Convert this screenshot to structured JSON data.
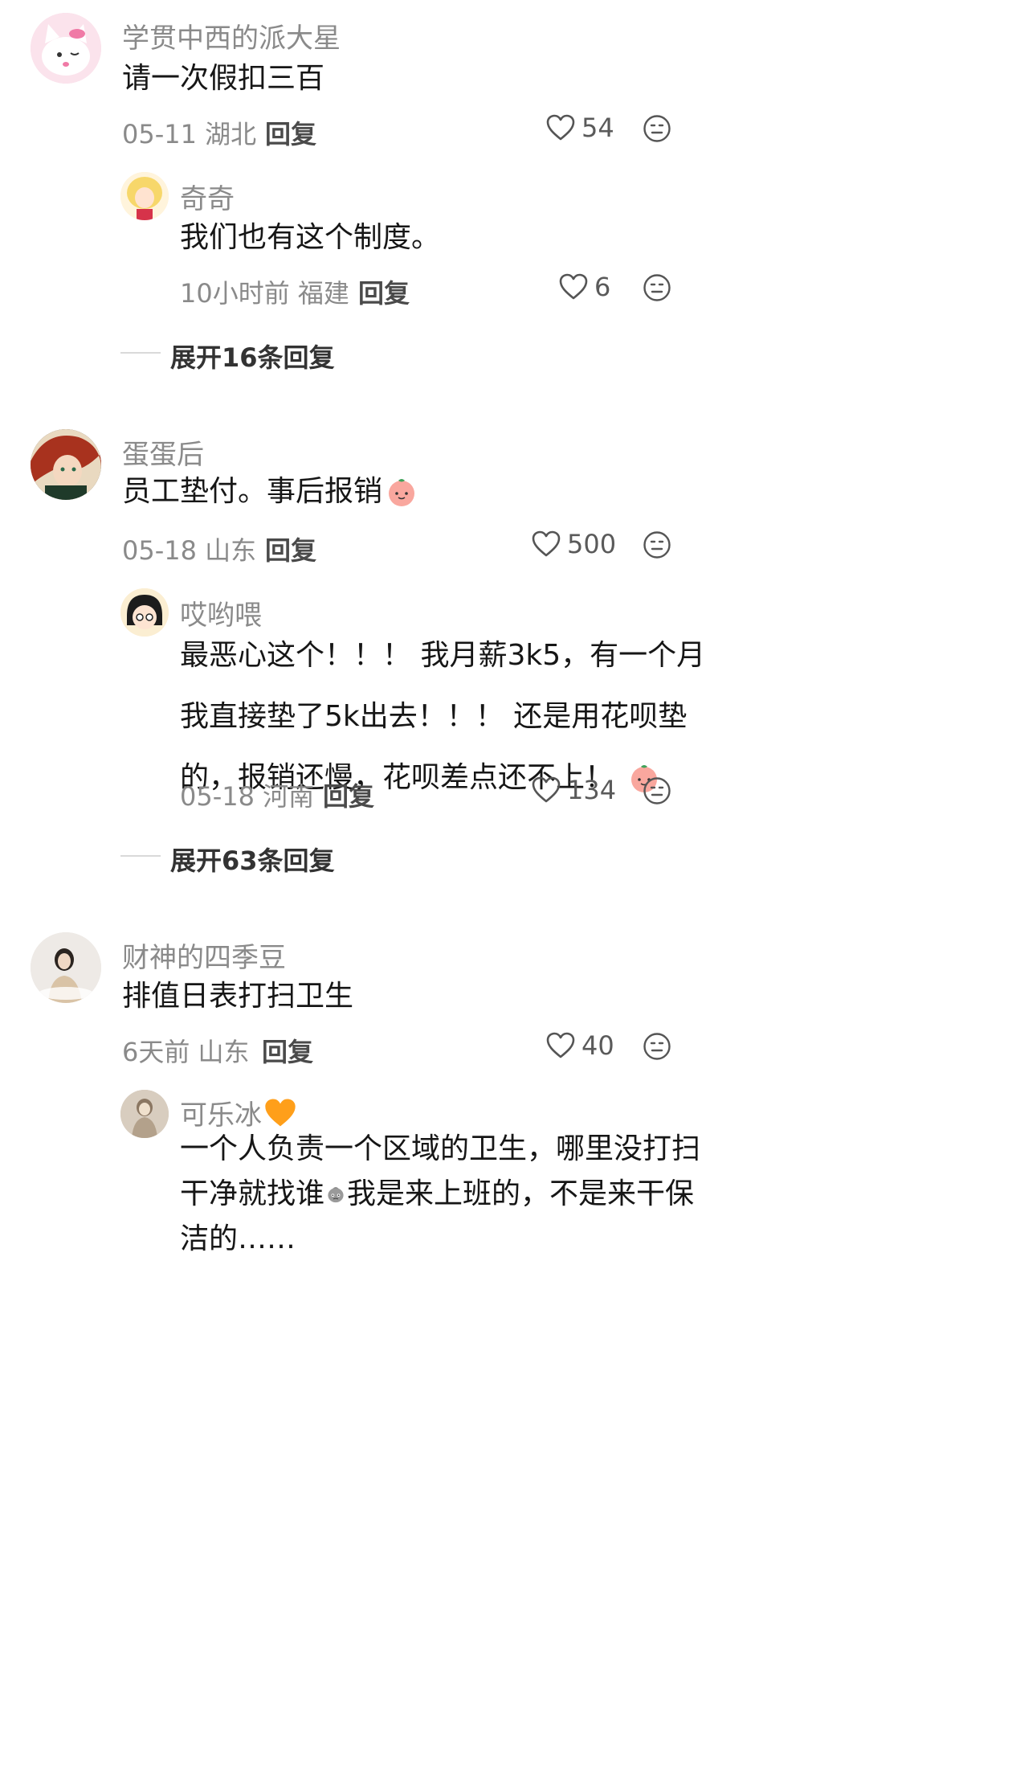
{
  "comments": [
    {
      "user": "学贯中西的派大星",
      "text": "请一次假扣三百",
      "meta": "05-11 湖北",
      "reply_label": "回复",
      "likes": "54",
      "replies": [
        {
          "user": "奇奇",
          "text": "我们也有这个制度。",
          "meta": "10小时前 福建",
          "reply_label": "回复",
          "likes": "6"
        }
      ],
      "expand_label": "展开16条回复"
    },
    {
      "user": "蛋蛋后",
      "text": "员工垫付。事后报销",
      "meta": "05-18 山东",
      "reply_label": "回复",
      "likes": "500",
      "replies": [
        {
          "user": "哎哟喂",
          "text_lines": [
            "最恶心这个！！！ 我月薪3k5，有一个月",
            "我直接垫了5k出去！！！ 还是用花呗垫",
            "的，报销还慢，花呗差点还不上！"
          ],
          "meta": "05-18 河南",
          "reply_label": "回复",
          "likes": "134"
        }
      ],
      "expand_label": "展开63条回复"
    },
    {
      "user": "财神的四季豆",
      "text": "排值日表打扫卫生",
      "meta": "6天前 山东",
      "reply_label": "回复",
      "likes": "40",
      "replies": [
        {
          "user": "可乐冰",
          "text_lines": [
            "一个人负责一个区域的卫生，哪里没打扫",
            "干净就找谁",
            "我是来上班的，不是来干保",
            "洁的……"
          ]
        }
      ]
    }
  ],
  "icons": {
    "like": "heart-outline-icon",
    "dislike": "neutral-face-icon",
    "emoji": "peach-face-emoji",
    "emoji2": "gray-face-emoji",
    "heart_emoji": "orange-heart-emoji"
  },
  "colors": {
    "username": "#8a8a8a",
    "body_text": "#161616",
    "heart_orange": "#ff9f1a"
  }
}
